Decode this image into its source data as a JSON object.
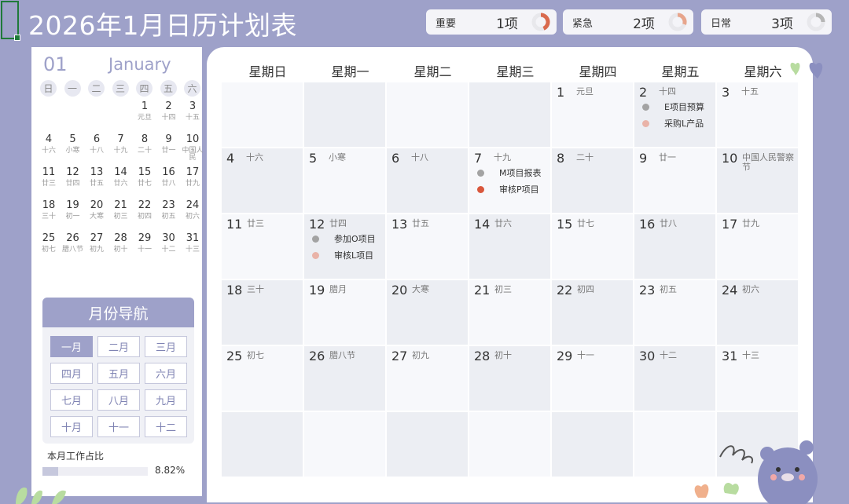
{
  "title": "2026年1月日历计划表",
  "stats": [
    {
      "label": "重要",
      "count": "1项",
      "color": "#d96a4e"
    },
    {
      "label": "紧急",
      "count": "2项",
      "color": "#e7a58c"
    },
    {
      "label": "日常",
      "count": "3项",
      "color": "#b5b5b5"
    }
  ],
  "mini": {
    "day": "01",
    "month": "January",
    "weekdays": [
      "日",
      "一",
      "二",
      "三",
      "四",
      "五",
      "六"
    ],
    "rows": [
      [
        {
          "n": "",
          "l": ""
        },
        {
          "n": "",
          "l": ""
        },
        {
          "n": "",
          "l": ""
        },
        {
          "n": "",
          "l": ""
        },
        {
          "n": "1",
          "l": "元旦"
        },
        {
          "n": "2",
          "l": "十四"
        },
        {
          "n": "3",
          "l": "十五"
        }
      ],
      [
        {
          "n": "4",
          "l": "十六"
        },
        {
          "n": "5",
          "l": "小寒"
        },
        {
          "n": "6",
          "l": "十八"
        },
        {
          "n": "7",
          "l": "十九"
        },
        {
          "n": "8",
          "l": "二十"
        },
        {
          "n": "9",
          "l": "廿一"
        },
        {
          "n": "10",
          "l": "中国人民"
        }
      ],
      [
        {
          "n": "11",
          "l": "廿三"
        },
        {
          "n": "12",
          "l": "廿四"
        },
        {
          "n": "13",
          "l": "廿五"
        },
        {
          "n": "14",
          "l": "廿六"
        },
        {
          "n": "15",
          "l": "廿七"
        },
        {
          "n": "16",
          "l": "廿八"
        },
        {
          "n": "17",
          "l": "廿九"
        }
      ],
      [
        {
          "n": "18",
          "l": "三十"
        },
        {
          "n": "19",
          "l": "初一"
        },
        {
          "n": "20",
          "l": "大寒"
        },
        {
          "n": "21",
          "l": "初三"
        },
        {
          "n": "22",
          "l": "初四"
        },
        {
          "n": "23",
          "l": "初五"
        },
        {
          "n": "24",
          "l": "初六"
        }
      ],
      [
        {
          "n": "25",
          "l": "初七"
        },
        {
          "n": "26",
          "l": "腊八节"
        },
        {
          "n": "27",
          "l": "初九"
        },
        {
          "n": "28",
          "l": "初十"
        },
        {
          "n": "29",
          "l": "十一"
        },
        {
          "n": "30",
          "l": "十二"
        },
        {
          "n": "31",
          "l": "十三"
        }
      ]
    ]
  },
  "nav": {
    "title": "月份导航",
    "months": [
      "一月",
      "二月",
      "三月",
      "四月",
      "五月",
      "六月",
      "七月",
      "八月",
      "九月",
      "十月",
      "十一",
      "十二"
    ],
    "active_index": 0
  },
  "progress": {
    "label": "本月工作占比",
    "value": "8.82%",
    "fraction": 0.0882
  },
  "calendar": {
    "weekdays": [
      "星期日",
      "星期一",
      "星期二",
      "星期三",
      "星期四",
      "星期五",
      "星期六"
    ],
    "weeks": [
      [
        {
          "n": "",
          "l": ""
        },
        {
          "n": "",
          "l": ""
        },
        {
          "n": "",
          "l": ""
        },
        {
          "n": "",
          "l": ""
        },
        {
          "n": "1",
          "l": "元旦"
        },
        {
          "n": "2",
          "l": "十四"
        },
        {
          "n": "3",
          "l": "十五"
        }
      ],
      [
        {
          "n": "4",
          "l": "十六"
        },
        {
          "n": "5",
          "l": "小寒"
        },
        {
          "n": "6",
          "l": "十八"
        },
        {
          "n": "7",
          "l": "十九"
        },
        {
          "n": "8",
          "l": "二十"
        },
        {
          "n": "9",
          "l": "廿一"
        },
        {
          "n": "10",
          "l": "中国人民警察节"
        }
      ],
      [
        {
          "n": "11",
          "l": "廿三"
        },
        {
          "n": "12",
          "l": "廿四"
        },
        {
          "n": "13",
          "l": "廿五"
        },
        {
          "n": "14",
          "l": "廿六"
        },
        {
          "n": "15",
          "l": "廿七"
        },
        {
          "n": "16",
          "l": "廿八"
        },
        {
          "n": "17",
          "l": "廿九"
        }
      ],
      [
        {
          "n": "18",
          "l": "三十"
        },
        {
          "n": "19",
          "l": "腊月"
        },
        {
          "n": "20",
          "l": "大寒"
        },
        {
          "n": "21",
          "l": "初三"
        },
        {
          "n": "22",
          "l": "初四"
        },
        {
          "n": "23",
          "l": "初五"
        },
        {
          "n": "24",
          "l": "初六"
        }
      ],
      [
        {
          "n": "25",
          "l": "初七"
        },
        {
          "n": "26",
          "l": "腊八节"
        },
        {
          "n": "27",
          "l": "初九"
        },
        {
          "n": "28",
          "l": "初十"
        },
        {
          "n": "29",
          "l": "十一"
        },
        {
          "n": "30",
          "l": "十二"
        },
        {
          "n": "31",
          "l": "十三"
        }
      ],
      [
        {
          "n": "",
          "l": ""
        },
        {
          "n": "",
          "l": ""
        },
        {
          "n": "",
          "l": ""
        },
        {
          "n": "",
          "l": ""
        },
        {
          "n": "",
          "l": ""
        },
        {
          "n": "",
          "l": ""
        },
        {
          "n": "",
          "l": ""
        }
      ]
    ],
    "events": {
      "2": [
        {
          "text": "E项目预算",
          "color": "#a3a3a3"
        },
        {
          "text": "采购L产品",
          "color": "#e9b3a8"
        }
      ],
      "7": [
        {
          "text": "M项目报表",
          "color": "#a3a3a3"
        },
        {
          "text": "审核P项目",
          "color": "#d9573c"
        }
      ],
      "12": [
        {
          "text": "参加O项目",
          "color": "#a3a3a3"
        },
        {
          "text": "审核L项目",
          "color": "#e9b3a8"
        }
      ]
    }
  },
  "colors": {
    "accent": "#9ea1c9",
    "cell": "#f7f8fb",
    "cell_alt": "#eceef3"
  }
}
